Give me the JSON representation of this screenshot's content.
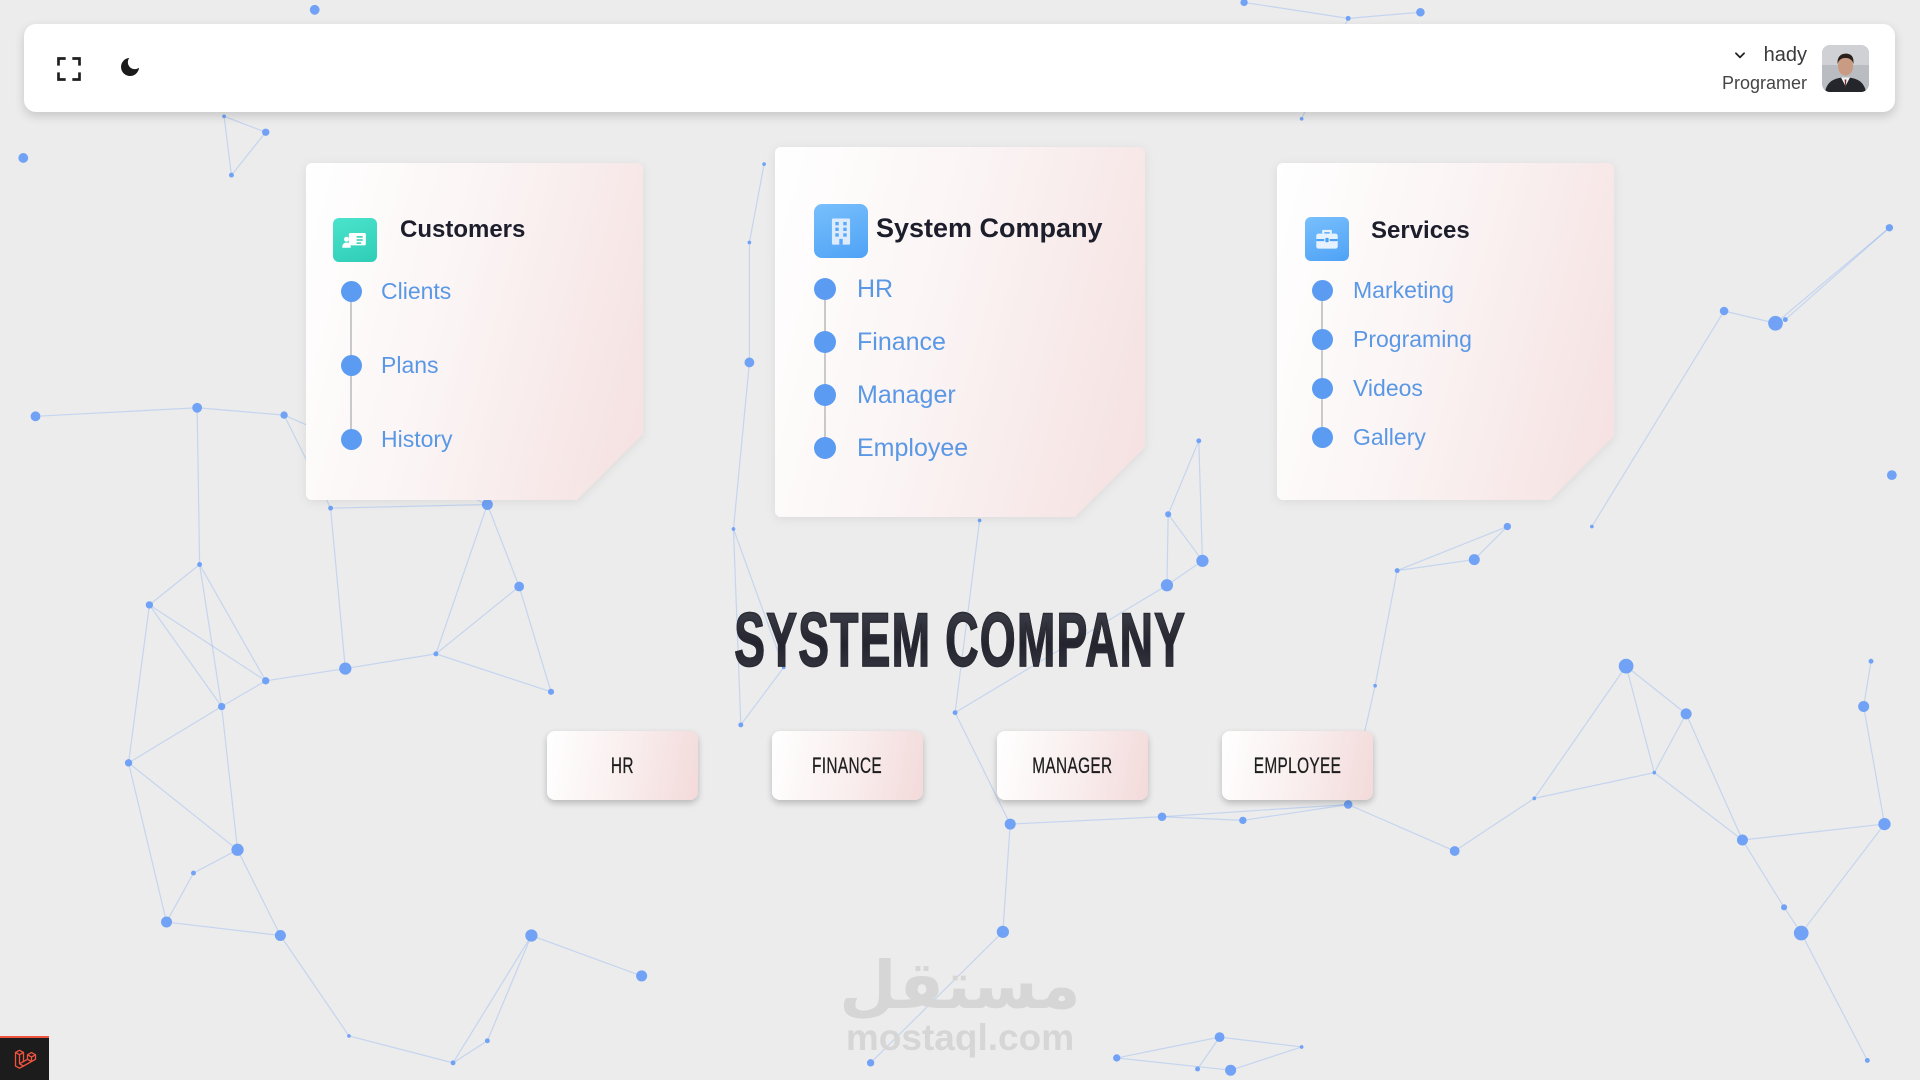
{
  "header": {
    "fullscreen_icon": "fullscreen-icon",
    "theme_toggle_icon": "moon-icon",
    "user": {
      "name": "hady",
      "role": "Programer",
      "dropdown_icon": "chevron-down-icon",
      "avatar": "user-avatar"
    }
  },
  "cards": [
    {
      "title": "Customers",
      "icon": "address-card-icon",
      "items": [
        "Clients",
        "Plans",
        "History"
      ]
    },
    {
      "title": "System Company",
      "icon": "building-icon",
      "items": [
        "HR",
        "Finance",
        "Manager",
        "Employee"
      ]
    },
    {
      "title": "Services",
      "icon": "toolbox-icon",
      "items": [
        "Marketing",
        "Programing",
        "Videos",
        "Gallery"
      ]
    }
  ],
  "hero": {
    "title": "SYSTEM COMPANY"
  },
  "quick_links": [
    "HR",
    "FINANCE",
    "MANAGER",
    "EMPLOYEE"
  ],
  "watermark": {
    "arabic": "مستقل",
    "latin": "mostaql.com"
  },
  "debugbar": {
    "icon": "laravel-icon"
  },
  "colors": {
    "background": "#ececec",
    "accent_blue": "#5b9cf2",
    "link_text": "#5a98e6",
    "customers_icon": "#2fcdb6",
    "company_icon": "#4ea2f6",
    "services_icon": "#4ea2f6",
    "card_tint": "#f5e0e0",
    "network": "#6a9ef5",
    "debugbar_accent": "#f0533f"
  }
}
